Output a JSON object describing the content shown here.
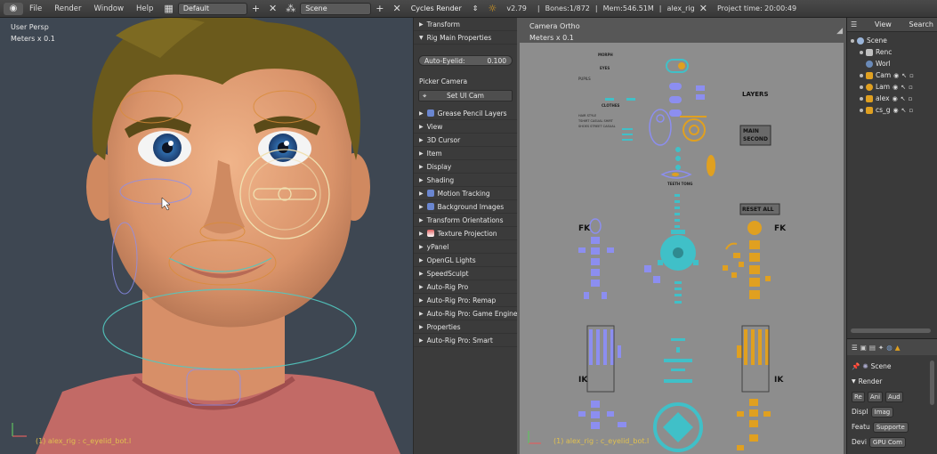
{
  "topbar": {
    "menus": [
      "File",
      "Render",
      "Window",
      "Help"
    ],
    "screen_layout": "Default",
    "scene": "Scene",
    "render_engine": "Cycles Render",
    "version": "v2.79",
    "bones": "Bones:1/872",
    "mem": "Mem:546.51M",
    "object": "alex_rig",
    "project_time": "Project time: 20:00:49"
  },
  "viewport": {
    "view_name": "User Persp",
    "units": "Meters x 0.1",
    "status": "(1) alex_rig : c_eyelid_bot.l"
  },
  "npanel": {
    "transform": "Transform",
    "rig_main": "Rig Main Properties",
    "auto_eyelid_label": "Auto-Eyelid:",
    "auto_eyelid_value": "0.100",
    "picker_camera": "Picker Camera",
    "set_ui_cam": "Set UI Cam",
    "panels": [
      "Grease Pencil Layers",
      "View",
      "3D Cursor",
      "Item",
      "Display",
      "Shading",
      "Motion Tracking",
      "Background Images",
      "Transform Orientations",
      "Texture Projection",
      "yPanel",
      "OpenGL Lights",
      "SpeedSculpt",
      "Auto-Rig Pro",
      "Auto-Rig Pro: Remap",
      "Auto-Rig Pro: Game Engine E",
      "Properties",
      "Auto-Rig Pro: Smart"
    ]
  },
  "camview": {
    "view_name": "Camera Ortho",
    "units": "Meters x 0.1",
    "status": "(1) alex_rig : c_eyelid_bot.l",
    "labels": {
      "morph": "MORPH",
      "eyes": "EYES",
      "pupils": "PUPILS",
      "clothes": "CLOTHES",
      "hair_style": "HAIR STYLE",
      "tshirt": "TSHIRT CASUAL SHIRT",
      "shoes": "SHOES STREET CASUAL",
      "teeth": "TEETH  TONG",
      "layers": "LAYERS",
      "main": "MAIN",
      "second": "SECOND",
      "reset_all": "RESET ALL",
      "fk_left": "FK",
      "fk_right": "FK",
      "ik_left": "IK",
      "ik_right": "IK"
    }
  },
  "outliner": {
    "view": "View",
    "search": "Search",
    "items": [
      "Scene",
      "Renc",
      "Worl",
      "Cam",
      "Lam",
      "alex",
      "cs_g"
    ]
  },
  "properties": {
    "scene": "Scene",
    "render": "Render",
    "buttons": [
      "Re",
      "Ani",
      "Aud"
    ],
    "display_label": "Displ",
    "display_value": "Imag",
    "feature_label": "Featu",
    "feature_value": "Supporte",
    "device_label": "Devi",
    "device_value": "GPU Com"
  },
  "colors": {
    "accent_orange": "#e0a020",
    "picker_blue": "#8c8ef0",
    "picker_cyan": "#40c0c8",
    "status_yellow": "#e0c050"
  }
}
